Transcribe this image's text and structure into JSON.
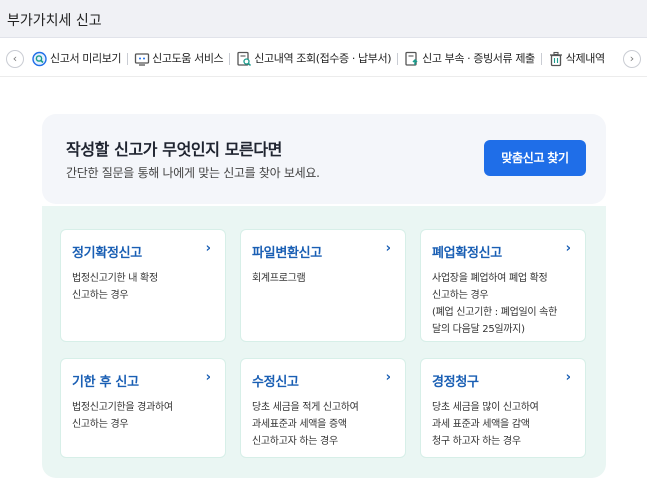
{
  "window": {
    "title": "부가가치세 신고"
  },
  "toolbar": {
    "prev_label": "‹",
    "next_label": "›",
    "items": [
      {
        "label": "신고서 미리보기",
        "icon": "magnifier-doc-icon"
      },
      {
        "label": "신고도움 서비스",
        "icon": "monitor-help-icon"
      },
      {
        "label": "신고내역 조회(접수증 · 납부서)",
        "icon": "doc-search-icon"
      },
      {
        "label": "신고 부속 · 증빙서류 제출",
        "icon": "doc-upload-icon"
      },
      {
        "label": "삭제내역",
        "icon": "trash-icon"
      }
    ]
  },
  "banner": {
    "title": "작성할 신고가 무엇인지 모른다면",
    "description": "간단한 질문을 통해 나에게 맞는 신고를 찾아 보세요.",
    "button_label": "맞춤신고 찾기"
  },
  "cards": [
    {
      "title": "정기확정신고",
      "lines": [
        "법정신고기한 내 확정",
        "신고하는 경우"
      ]
    },
    {
      "title": "파일변환신고",
      "lines": [
        "회계프로그램"
      ]
    },
    {
      "title": "폐업확정신고",
      "lines": [
        "사업장을 폐업하여 폐업 확정",
        "신고하는 경우",
        "(폐업 신고기한 : 폐업일이 속한",
        "달의 다음달 25일까지)"
      ]
    },
    {
      "title": "기한 후 신고",
      "lines": [
        "법정신고기한을 경과하여",
        "신고하는 경우"
      ]
    },
    {
      "title": "수정신고",
      "lines": [
        "당초 세금을 적게 신고하여",
        "과세표준과 세액을 증액",
        "신고하고자 하는 경우"
      ]
    },
    {
      "title": "경정청구",
      "lines": [
        "당초 세금을 많이 신고하여",
        "과세 표준과 세액을 감액",
        "청구 하고자 하는 경우"
      ]
    }
  ],
  "colors": {
    "accent": "#1f6ee8",
    "card_title": "#1a5fb4",
    "grid_bg": "#eaf6f3",
    "banner_bg": "#f4f6fa"
  }
}
